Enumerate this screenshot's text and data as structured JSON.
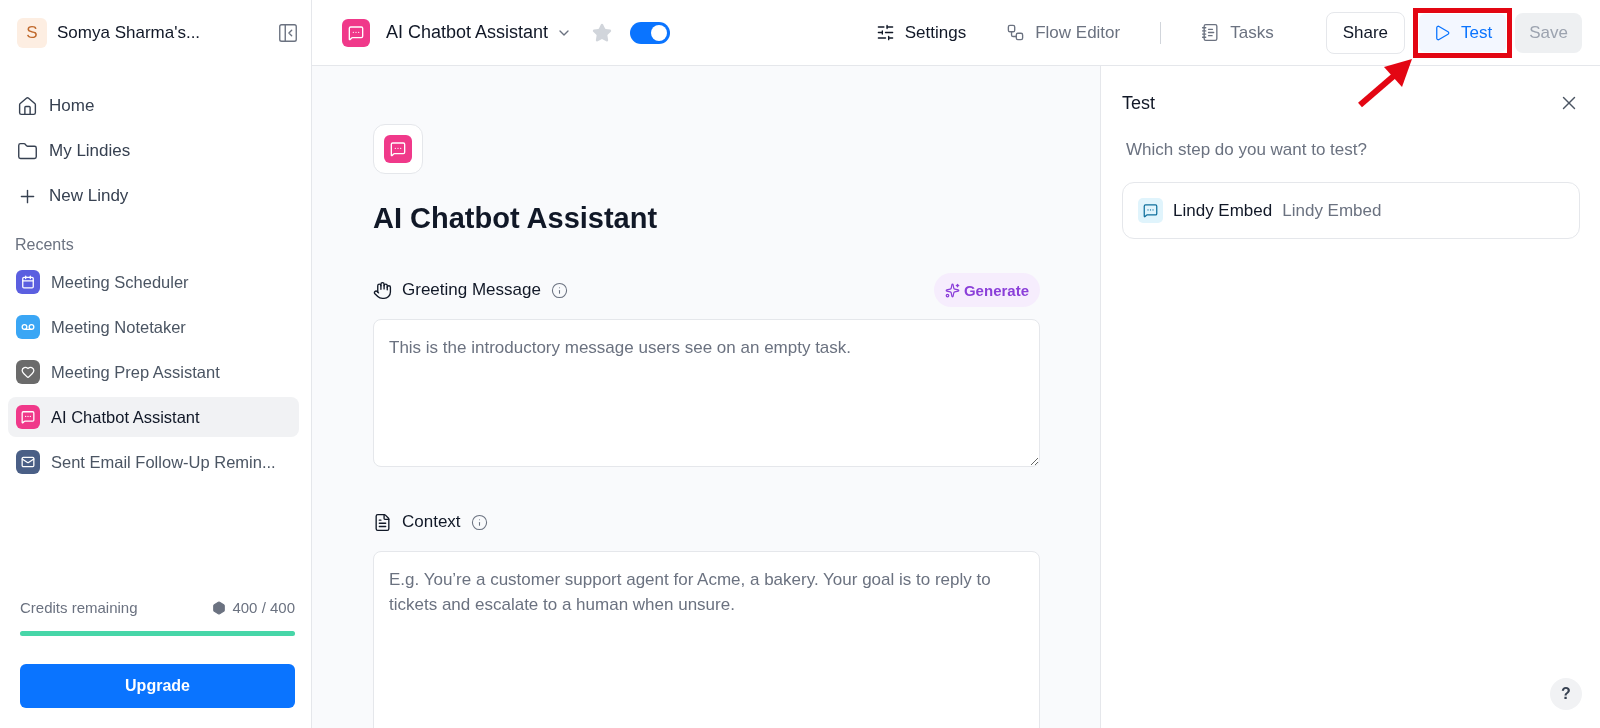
{
  "sidebar": {
    "workspace": {
      "initial": "S",
      "name": "Somya Sharma's..."
    },
    "nav": [
      {
        "label": "Home",
        "selected": false
      },
      {
        "label": "My Lindies",
        "selected": false
      },
      {
        "label": "New Lindy",
        "selected": false
      }
    ],
    "recents_heading": "Recents",
    "recents": [
      {
        "label": "Meeting Scheduler",
        "color": "#5b5fe0",
        "selected": false
      },
      {
        "label": "Meeting Notetaker",
        "color": "#3aa6f5",
        "selected": false
      },
      {
        "label": "Meeting Prep Assistant",
        "color": "#6b6b6b",
        "selected": false
      },
      {
        "label": "AI Chatbot Assistant",
        "color": "#f0398a",
        "selected": true
      },
      {
        "label": "Sent Email Follow-Up Remin...",
        "color": "#4a5f86",
        "selected": false
      }
    ],
    "credits": {
      "label": "Credits remaining",
      "reading": "400 / 400",
      "level": 1
    },
    "upgrade": "Upgrade"
  },
  "header": {
    "title": "AI Chatbot Assistant",
    "starred": false,
    "enabled": true,
    "tabs": [
      {
        "label": "Settings",
        "selected": true
      },
      {
        "label": "Flow Editor",
        "selected": false
      },
      {
        "label": "Tasks",
        "selected": false
      }
    ],
    "share": "Share",
    "test": {
      "label": "Test",
      "highlighted": true
    },
    "save": {
      "label": "Save",
      "disabled": true
    }
  },
  "editor": {
    "title": "AI Chatbot Assistant",
    "fields": [
      {
        "label": "Greeting Message",
        "placeholder": "This is the introductory message users see on an empty task.",
        "action": "Generate"
      },
      {
        "label": "Context",
        "placeholder": "E.g. You’re a customer support agent for Acme, a bakery. Your goal is to reply to tickets and escalate to a human when unsure."
      }
    ]
  },
  "test_panel": {
    "title": "Test",
    "question": "Which step do you want to test?",
    "steps": [
      {
        "name": "Lindy Embed",
        "type": "Lindy Embed"
      }
    ]
  },
  "help": "?"
}
